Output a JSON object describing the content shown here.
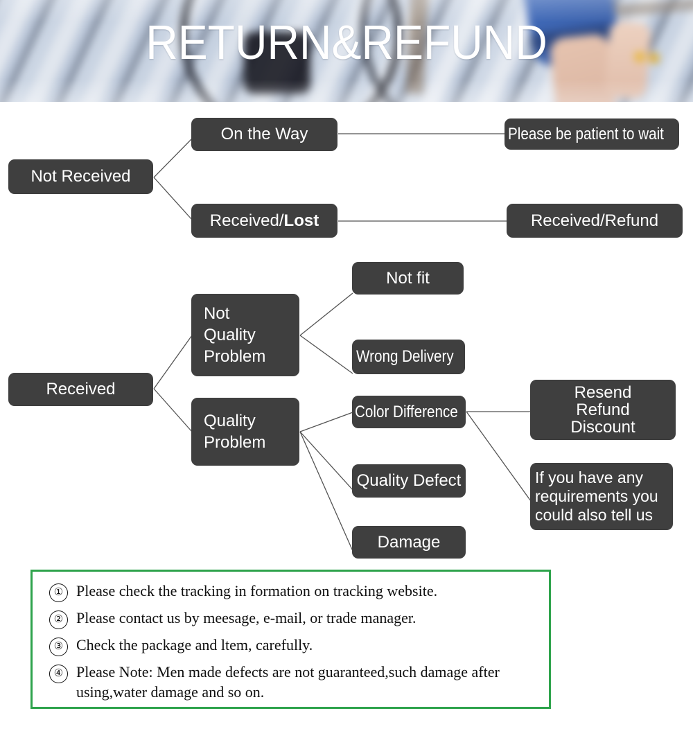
{
  "banner": {
    "title": "RETURN&REFUND",
    "background_image": "blurred-photo-wooden-deck-bicycle-person-legs",
    "title_color": "#ffffff"
  },
  "flowchart": {
    "node_color": "#3f3f3f",
    "node_text_color": "#ffffff",
    "connector_color": "#555555",
    "nodes": {
      "not_received": "Not Received",
      "on_the_way": "On the Way",
      "received_lost_prefix": "Received/",
      "received_lost_bold": "Lost",
      "please_be_patient": "Please be patient to wait",
      "received_refund": "Received/Refund",
      "received": "Received",
      "not_quality_problem": "Not\nQuality\nProblem",
      "quality_problem": "Quality\nProblem",
      "not_fit": "Not fit",
      "wrong_delivery": "Wrong Delivery",
      "color_difference": "Color Difference",
      "quality_defect": "Quality Defect",
      "damage": "Damage",
      "resend_refund_discount": "Resend\nRefund\nDiscount",
      "requirements": "If you have any requirements you could also tell us"
    }
  },
  "notes": {
    "border_color": "#2ea34c",
    "items": [
      {
        "num": "①",
        "text": "Please check the tracking in formation on tracking website."
      },
      {
        "num": "②",
        "text": "Please contact us by meesage, e-mail, or trade manager."
      },
      {
        "num": "③",
        "text": "Check the package and ltem, carefully."
      },
      {
        "num": "④",
        "text": "Please Note: Men made defects  are not guaranteed,such damage after using,water damage and so on."
      }
    ]
  }
}
